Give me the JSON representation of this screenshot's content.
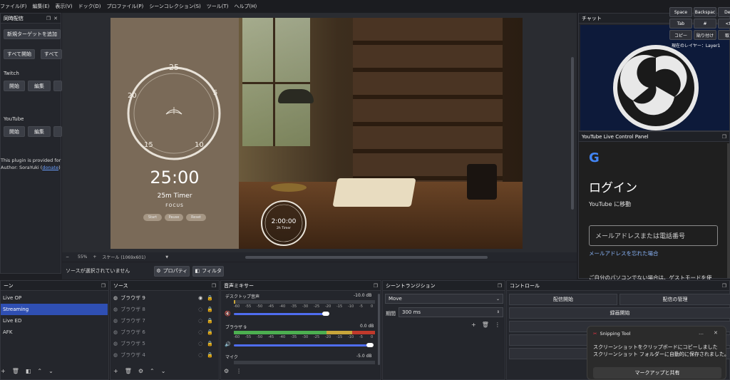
{
  "menu": [
    "ファイル(F)",
    "編集(E)",
    "表示(V)",
    "ドック(D)",
    "プロファイル(P)",
    "シーンコレクション(S)",
    "ツール(T)",
    "ヘルプ(H)"
  ],
  "multistream": {
    "title": "同時配信",
    "add_target": "新規ターゲットを追加",
    "start_all": "すべて開始",
    "stop_all": "すべて",
    "targets": [
      {
        "name": "Twitch",
        "start": "開始",
        "edit": "編集"
      },
      {
        "name": "YouTube",
        "start": "開始",
        "edit": "編集"
      }
    ],
    "note_line1": "This plugin is provided for f",
    "note_line2_prefix": "Author: SoraYuki (",
    "note_link": "donate",
    "note_line2_suffix": ")"
  },
  "preview": {
    "timer_big": "25:00",
    "timer_sub": "25m Timer",
    "timer_focus": "FOCUS",
    "dial_nums": [
      "25",
      "5",
      "10",
      "15",
      "20"
    ],
    "btn_start": "Start",
    "btn_pause": "Pause",
    "btn_reset": "Reset",
    "small_timer": "2:00:00",
    "small_timer_sub": "2h Timer",
    "zoom": "55%",
    "scale": "スケール (1069x601)"
  },
  "source_toolbar": {
    "status": "ソースが選択されていません",
    "properties": "プロパティ",
    "filters": "フィルタ"
  },
  "scenes": {
    "title": "ーン",
    "items": [
      "Live OP",
      "Streaming",
      "Live ED",
      "AFK"
    ],
    "selected": 1
  },
  "sources": {
    "title": "ソース",
    "items": [
      "ブラウザ 9",
      "ブラウザ 8",
      "ブラウザ 7",
      "ブラウザ 6",
      "ブラウザ 5",
      "ブラウザ 4"
    ]
  },
  "mixer": {
    "title": "音声ミキサー",
    "channels": [
      {
        "name": "デスクトップ音声",
        "db": "-10.0 dB"
      },
      {
        "name": "ブラウザ 9",
        "db": "0.0 dB"
      },
      {
        "name": "マイク",
        "db": "-5.0 dB"
      }
    ],
    "ticks": [
      "-60",
      "-55",
      "-50",
      "-45",
      "-40",
      "-35",
      "-30",
      "-25",
      "-20",
      "-15",
      "-10",
      "-5",
      "0"
    ]
  },
  "transitions": {
    "title": "シーントランジション",
    "selected": "Move",
    "duration_label": "期間",
    "duration_value": "300 ms"
  },
  "controls": {
    "title": "コントロール",
    "start_stream": "配信開始",
    "manage_stream": "配信の管理",
    "start_record": "録画開始"
  },
  "chat": {
    "title": "チャット"
  },
  "keyboard": {
    "keys": [
      "Space",
      "Backspac",
      "Dele",
      "Tab",
      "#",
      "<ta",
      "コピー",
      "貼り付け",
      "取り"
    ],
    "layer_label": "現在のレイヤー：",
    "layer_value": "Layer1"
  },
  "yt_panel": {
    "title": "YouTube Live Control Panel",
    "login": "ログイン",
    "move_to": "YouTube に移動",
    "email_placeholder": "メールアドレスまたは電話番号",
    "forgot": "メールアドレスを忘れた場合",
    "guest_hint": "ご自分のパソコンでない場合は、ゲストモードを使"
  },
  "toast": {
    "app": "Snipping Tool",
    "line1": "スクリーンショットをクリップボードにコピーしました",
    "line2": "スクリーンショット フォルダーに自動的に保存されました。",
    "action": "マークアップと共有",
    "more": "…",
    "close": "✕"
  },
  "colors": {
    "accent": "#2f4fb3",
    "meter_green": "#4caf50",
    "meter_yellow": "#c8a53a",
    "meter_red": "#c0392b"
  }
}
